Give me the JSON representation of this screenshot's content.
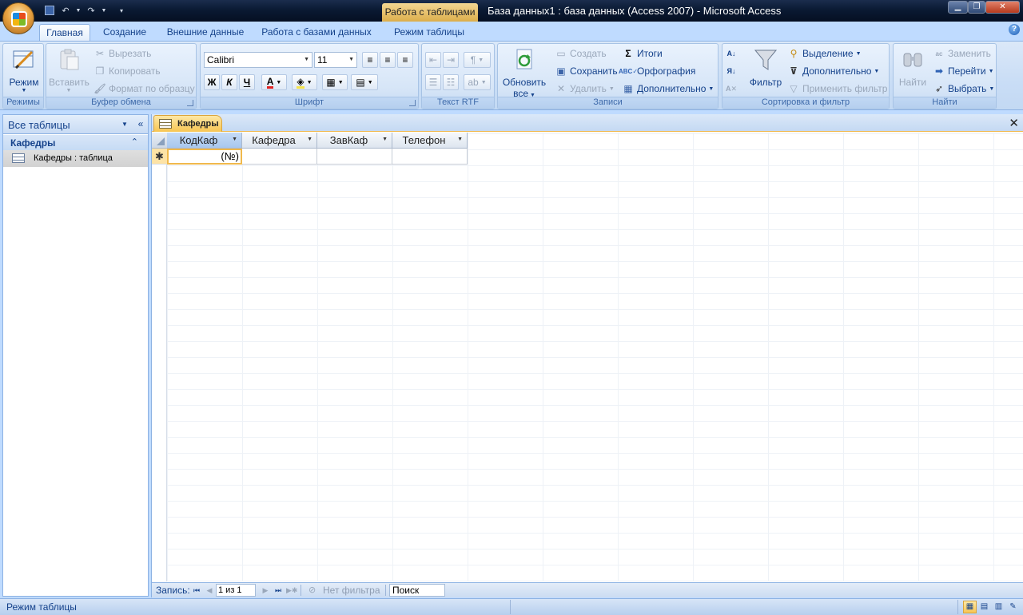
{
  "window": {
    "context_tab": "Работа с таблицами",
    "title": "База данных1 : база данных (Access 2007) - Microsoft Access",
    "minimize": "▁",
    "maximize": "❐",
    "close": "✕"
  },
  "ribbon_tabs": [
    {
      "label": "Главная",
      "active": true
    },
    {
      "label": "Создание"
    },
    {
      "label": "Внешние данные"
    },
    {
      "label": "Работа с базами данных"
    },
    {
      "label": "Режим таблицы"
    }
  ],
  "help": "?",
  "groups": {
    "views": {
      "label": "Режимы",
      "mode_button": "Режим"
    },
    "clipboard": {
      "label": "Буфер обмена",
      "paste": "Вставить",
      "cut": "Вырезать",
      "copy": "Копировать",
      "format_painter": "Формат по образцу"
    },
    "font": {
      "label": "Шрифт",
      "font_name": "Calibri",
      "font_size": "11",
      "bold": "Ж",
      "italic": "К",
      "underline": "Ч",
      "font_color_glyph": "A"
    },
    "rich_text": {
      "label": "Текст RTF"
    },
    "records": {
      "label": "Записи",
      "refresh_line1": "Обновить",
      "refresh_line2": "все",
      "new": "Создать",
      "save": "Сохранить",
      "delete": "Удалить",
      "totals": "Итоги",
      "spelling": "Орфография",
      "more": "Дополнительно"
    },
    "sort_filter": {
      "label": "Сортировка и фильтр",
      "filter": "Фильтр",
      "selection": "Выделение",
      "advanced": "Дополнительно",
      "apply_filter": "Применить фильтр"
    },
    "find": {
      "label": "Найти",
      "find": "Найти",
      "replace": "Заменить",
      "goto": "Перейти",
      "select": "Выбрать"
    }
  },
  "nav_pane": {
    "title": "Все таблицы",
    "group": "Кафедры",
    "item": "Кафедры : таблица"
  },
  "document": {
    "tab_label": "Кафедры",
    "columns": [
      "КодКаф",
      "Кафедра",
      "ЗавКаф",
      "Телефон"
    ],
    "new_row_marker": "✱",
    "new_row_value": "(№)"
  },
  "record_nav": {
    "label": "Запись:",
    "current": "1 из 1",
    "no_filter": "Нет фильтра",
    "search": "Поиск"
  },
  "status": {
    "text": "Режим таблицы"
  }
}
